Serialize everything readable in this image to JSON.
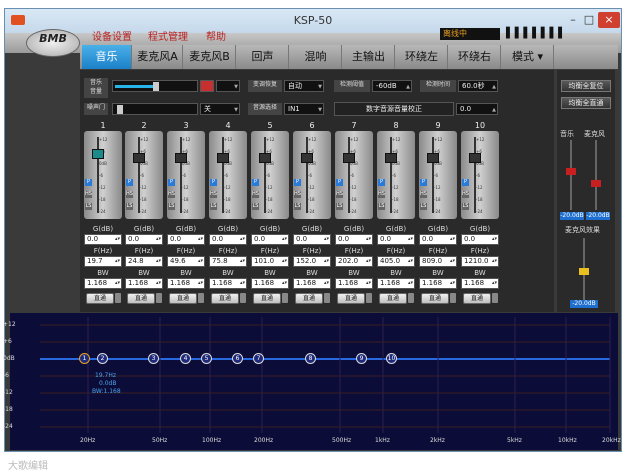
{
  "window": {
    "title": "KSP-50",
    "min": "–",
    "max": "□",
    "close": "×"
  },
  "logo": "BMB",
  "menu": {
    "items": [
      "设备设置",
      "程式管理",
      "帮助"
    ],
    "status": "离线中",
    "dots": "▌▌▌▌▌▌▌"
  },
  "tabs": [
    "音乐",
    "麦克风A",
    "麦克风B",
    "回声",
    "混响",
    "主输出",
    "环绕左",
    "环绕右",
    "模式 ▾"
  ],
  "controls": {
    "music_volume": "音乐\n音量",
    "music_volume_fraction": 0.52,
    "noise_gate": "噪声门",
    "noise_gate_value": "关",
    "noise_gate_fraction": 0.05,
    "tone_reset": "变调恢复",
    "tone_reset_value": "自动",
    "source_select": "音源选择",
    "source_select_value": "IN1",
    "detect_threshold": "检测阈值",
    "detect_threshold_value": "-60dB",
    "detect_time": "检测时间",
    "detect_time_value": "60.0秒",
    "digital_calib": "数字音源音量校正",
    "digital_calib_value": "0.0"
  },
  "channel_labels": {
    "gain": "G(dB)",
    "freq": "F(Hz)",
    "bw": "BW",
    "bypass": "直通"
  },
  "ticks": [
    "+12",
    "+6",
    "0dB",
    "-6",
    "-12",
    "-18",
    "-24"
  ],
  "filter_buttons": [
    "P",
    "HS",
    "LS"
  ],
  "channels": [
    {
      "n": "1",
      "g": "0.0",
      "f": "19.7",
      "bw": "1.168"
    },
    {
      "n": "2",
      "g": "0.0",
      "f": "24.8",
      "bw": "1.168"
    },
    {
      "n": "3",
      "g": "0.0",
      "f": "49.6",
      "bw": "1.168"
    },
    {
      "n": "4",
      "g": "0.0",
      "f": "75.8",
      "bw": "1.168"
    },
    {
      "n": "5",
      "g": "0.0",
      "f": "101.0",
      "bw": "1.168"
    },
    {
      "n": "6",
      "g": "0.0",
      "f": "152.0",
      "bw": "1.168"
    },
    {
      "n": "7",
      "g": "0.0",
      "f": "202.0",
      "bw": "1.168"
    },
    {
      "n": "8",
      "g": "0.0",
      "f": "405.0",
      "bw": "1.168"
    },
    {
      "n": "9",
      "g": "0.0",
      "f": "809.0",
      "bw": "1.168"
    },
    {
      "n": "10",
      "g": "0.0",
      "f": "1210.0",
      "bw": "1.168"
    }
  ],
  "right": {
    "reset_eq": "均衡全复位",
    "direct_eq": "均衡全直通",
    "music": "音乐",
    "mic": "麦克风",
    "music_db": "-20.0dB",
    "mic_db": "-20.0dB",
    "mic_effect": "麦克风效果",
    "effect_db": "-20.0dB"
  },
  "graph": {
    "ylabels": [
      "+12",
      "+6",
      "0dB",
      "-6",
      "-12",
      "-18",
      "-24"
    ],
    "xlabels": [
      "20Hz",
      "50Hz",
      "100Hz",
      "200Hz",
      "500Hz",
      "1kHz",
      "2kHz",
      "5kHz",
      "10kHz",
      "20kHz"
    ],
    "info": [
      "19.7Hz",
      "0.0dB",
      "BW:1.168"
    ]
  },
  "watermark": "大歌编辑"
}
